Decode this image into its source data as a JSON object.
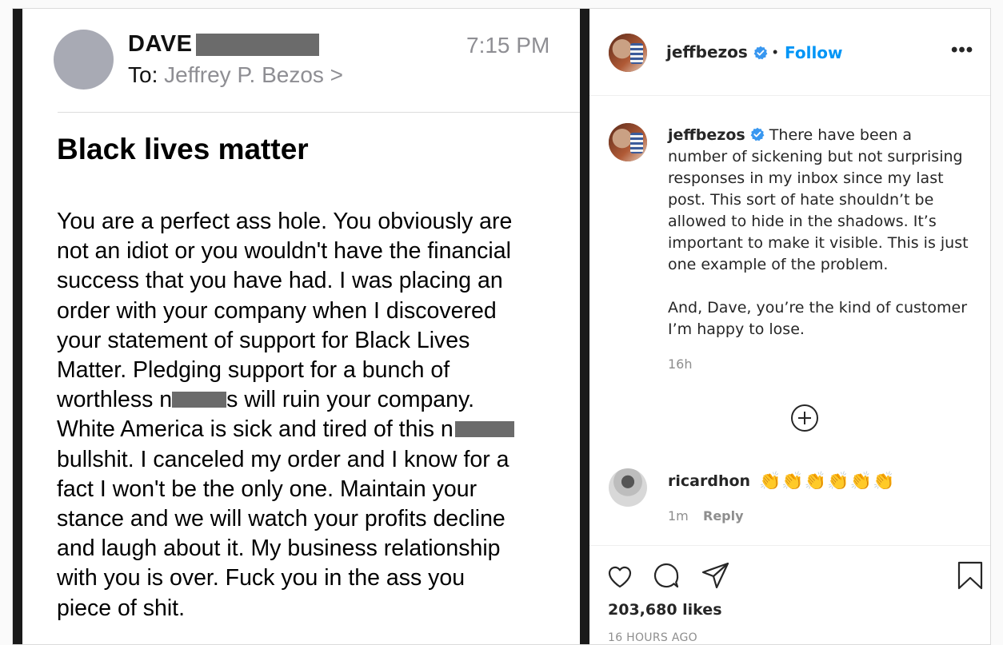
{
  "email": {
    "sender": "DAVE",
    "time": "7:15 PM",
    "to_label": "To:",
    "to_name": "Jeffrey P. Bezos",
    "to_chevron": ">",
    "subject": "Black lives matter",
    "body_lines": [
      "You are a perfect ass hole. You obviously are",
      "not an idiot or you wouldn't have the financial",
      "success that you have had. I was placing an",
      "order with your company when I discovered",
      "your statement of support for Black Lives",
      "Matter. Pledging support for a bunch of",
      "worthless n",
      "s will ruin your company.",
      "White America is sick and tired of this n",
      "bullshit. I canceled my order and I know for a",
      "fact I won't be the only one. Maintain your",
      "stance and we will watch your profits decline",
      "and laugh about it. My business relationship",
      "with you is over. Fuck you in the ass you",
      "piece of shit."
    ]
  },
  "post": {
    "username": "jeffbezos",
    "follow_dot": "•",
    "follow_label": "Follow",
    "more_label": "•••",
    "caption_p1": "There have been a number of sickening but not surprising responses in my inbox since my last post. This sort of hate shouldn’t be allowed to hide in the shadows. It’s important to make it visible. This is just one example of the problem.",
    "caption_p2": "And, Dave, you’re the kind of customer I’m happy to lose.",
    "caption_time": "16h",
    "likes": "203,680 likes",
    "posted": "16 HOURS AGO",
    "colors": {
      "accent": "#0095f6",
      "verified": "#3897f0",
      "muted": "#8e8e8e"
    }
  },
  "comment": {
    "username": "ricardhon",
    "text": "👏👏👏👏👏👏",
    "time": "1m",
    "reply_label": "Reply"
  },
  "icons": [
    "heart-icon",
    "comment-icon",
    "share-icon",
    "bookmark-icon",
    "plus-circle-icon",
    "verified-icon",
    "more-icon"
  ]
}
